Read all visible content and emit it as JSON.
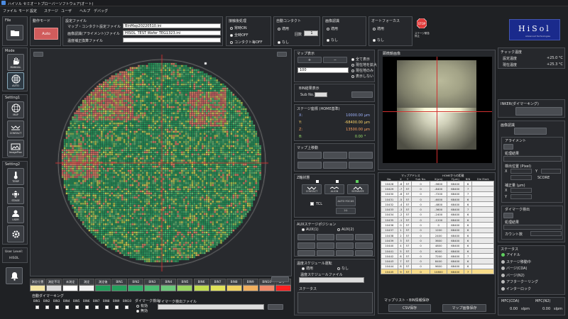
{
  "app": {
    "title": "ハイソル セミオートプローバーソフトウェア(オート)"
  },
  "menu": [
    "ファイル",
    "モード",
    "設定",
    "ステージ",
    "ユーザ",
    "ヘルプ",
    "デバッグ"
  ],
  "file": {
    "label": "File"
  },
  "run_mode": {
    "title": "動作モード",
    "button": "Auto"
  },
  "settings_file": {
    "title": "設定ファイル",
    "map_contact_label": "マップ・コンタクト設定ファイル",
    "map_contact_value": "BinMap20220510.ini",
    "image_align_label": "画像認識(アライメント)ファイル",
    "image_align_value": "HISOL_TEST Wafer TEG1323.ini",
    "temp_label": "温度補正換算ファイル",
    "temp_value": ""
  },
  "contact_after": {
    "title": "接触後処理",
    "options": [
      "常時ON",
      "全時OFF",
      "コンタクト毎OFF"
    ],
    "selected": 1
  },
  "auto_contact": {
    "title": "自動コンタクト",
    "opt_on": "適用",
    "opt_off": "なし",
    "count_label": "回数",
    "count": "1"
  },
  "image_recog": {
    "title": "画像認識",
    "opt_on": "適用",
    "opt_off": "なし"
  },
  "autofocus": {
    "title": "オートフォーカス",
    "opt_on": "適用",
    "opt_off": "なし"
  },
  "stop": {
    "label": "STOP",
    "caption": "ステージ緊急停止"
  },
  "logo": {
    "text": "HiSol",
    "sub": "Advanced Technologies"
  },
  "chuck_temp": {
    "title": "チャック温度",
    "set_label": "設定温度",
    "set_value": "+25.0 °C",
    "cur_label": "現在温度",
    "cur_value": "+25.3 °C"
  },
  "sidebar": {
    "mode_label": "Mode",
    "manual": "MANUAL",
    "auto": "AUTO",
    "setting1": "Setting1",
    "map": "MAP",
    "contact": "CONTACT",
    "image": "ImageProc",
    "setting2": "Setting2",
    "temp": "TEMP",
    "stage": "STAGE",
    "user": "USER",
    "user_level_label": "User Level:",
    "user_level": "HISOL"
  },
  "map_display": {
    "title": "マップ表示",
    "select": "100",
    "options": [
      "全て表示",
      "現在地を拡大",
      "現在地のみ",
      "表示しない"
    ],
    "selected": 0
  },
  "bin_display": {
    "title": "BIN結果表示",
    "subno_label": "Sub No."
  },
  "stage_coords": {
    "title": "ステージ座標 (HOME基準)",
    "x_label": "X:",
    "x": "10000.00",
    "y_label": "Y:",
    "y": "-68400.00",
    "z_label": "Z:",
    "z": "13500.00",
    "t_label": "θ:",
    "t": "0.00",
    "unit": "μm",
    "deg": "°"
  },
  "map_move": {
    "title": "マップ上移動"
  },
  "z_ctrl": {
    "title": "Z軸状態",
    "contact": "CONTACT",
    "align": "ALIGN",
    "separate": "SEPARATE",
    "tcl": "TCL",
    "auto_focus": "AUTO FOCUS",
    "lamp": "ﾗｲﾄ"
  },
  "aux": {
    "title": "AUXステージポジション",
    "opt1": "AUX(1)",
    "opt2": "AUX(2)"
  },
  "temp_sched": {
    "title": "温度スケジュール運転",
    "opt_on": "適用",
    "opt_off": "なし",
    "file_label": "温度スケジュールファイル",
    "status": "ステータス"
  },
  "camera": {
    "title": "顕微鏡画像"
  },
  "die_table": {
    "headers": [
      "No.",
      "X",
      "Y",
      "Sub No.",
      "X(μm)",
      "Y(μm)",
      "BIN",
      "Die Mark"
    ],
    "group_head1": "マップアドレス",
    "group_head2": "HOMEからの距離",
    "rows": [
      [
        "10428",
        "-6",
        "57",
        "0",
        "-9600",
        "68400",
        "6"
      ],
      [
        "10429",
        "-7",
        "57",
        "0",
        "-8400",
        "68400",
        "7"
      ],
      [
        "10430",
        "-6",
        "57",
        "0",
        "-7200",
        "68400",
        "7"
      ],
      [
        "10431",
        "-5",
        "57",
        "0",
        "-6000",
        "68400",
        "6"
      ],
      [
        "10432",
        "-4",
        "57",
        "0",
        "-4800",
        "68400",
        "6"
      ],
      [
        "10433",
        "-3",
        "57",
        "0",
        "-3600",
        "68400",
        "7"
      ],
      [
        "10434",
        "-2",
        "57",
        "0",
        "-2400",
        "68400",
        "6"
      ],
      [
        "10435",
        "-1",
        "57",
        "0",
        "-1200",
        "68400",
        "6"
      ],
      [
        "10436",
        "0",
        "57",
        "0",
        "0",
        "68400",
        "6"
      ],
      [
        "10437",
        "1",
        "57",
        "0",
        "1200",
        "68400",
        "6"
      ],
      [
        "10438",
        "2",
        "57",
        "0",
        "2400",
        "68400",
        "6"
      ],
      [
        "10439",
        "3",
        "57",
        "0",
        "3600",
        "68400",
        "6"
      ],
      [
        "10440",
        "4",
        "57",
        "0",
        "4800",
        "68400",
        "6"
      ],
      [
        "10441",
        "5",
        "57",
        "0",
        "6000",
        "68400",
        "6"
      ],
      [
        "10442",
        "6",
        "57",
        "0",
        "7200",
        "68400",
        "7"
      ],
      [
        "10443",
        "7",
        "57",
        "0",
        "8400",
        "68400",
        "6"
      ],
      [
        "10444",
        "8",
        "57",
        "0",
        "9600",
        "68400",
        "6"
      ],
      [
        "10445",
        "9",
        "57",
        "0",
        "10800",
        "68400",
        "7"
      ]
    ],
    "selected_row": 17
  },
  "map_bin_save": {
    "title": "マップリスト・BIN情報保存",
    "csv": "CSV保存",
    "image": "マップ画像保存"
  },
  "inker": {
    "title": "INKER(ダイマーキング)"
  },
  "image_recog_panel": {
    "title": "画像認識",
    "align": "アライメント",
    "result": "処理結果",
    "detect_pos": "検出位置 (Pixel)",
    "x": "X",
    "y": "Y",
    "score": "SCORE",
    "correction": "補正量 (μm)",
    "die_detect": "ダイマーク検出",
    "process_result": "処理結果",
    "count": "カウント数"
  },
  "status": {
    "title": "ステータス",
    "items": [
      "アイドル",
      "ステージ移動中",
      "バージ(CDA)",
      "バージ(N2)",
      "アフタークーリング",
      "インターロック"
    ],
    "active": 0
  },
  "mfc": {
    "cda_label": "MFC(CDA)",
    "cda": "0.00",
    "n2_label": "MFC(N2)",
    "n2": "0.00",
    "unit": "slpm"
  },
  "bin_legend": {
    "labels": [
      "測定位置",
      "測定不可",
      "未測定",
      "測定",
      "測定後",
      "BIN1",
      "BIN2",
      "BIN3",
      "BIN4",
      "BIN5",
      "BIN6",
      "BIN7",
      "BIN8",
      "BIN9",
      "BIN10",
      "エラー"
    ],
    "colors": [
      "#f5e7a5",
      "#d9d9d9",
      "#ffffff",
      "#f2f2f2",
      "#1e9e5a",
      "#24a05c",
      "#2fb06a",
      "#49bd72",
      "#6ac97a",
      "#98d45f",
      "#c1dd4f",
      "#e1e35a",
      "#f0d260",
      "#f2b05f",
      "#f08a6a",
      "#ff2020"
    ]
  },
  "auto_marking": {
    "title": "自動ダイマーキング",
    "bins": [
      "BIN1",
      "BIN2",
      "BIN3",
      "BIN4",
      "BIN5",
      "BIN6",
      "BIN7",
      "BIN8",
      "BIN9",
      "BIN10"
    ],
    "die_detect": "ダイマーク検出",
    "opt_on": "有効",
    "opt_off": "無効",
    "file": "ダイマーク検出ファイル"
  }
}
